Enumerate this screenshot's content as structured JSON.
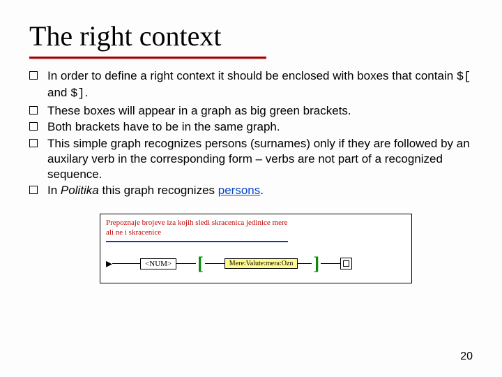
{
  "title": "The right context",
  "bullets": [
    {
      "pre": "In order to define a right context it should be enclosed with boxes that contain ",
      "code1": "$[",
      "mid": " and ",
      "code2": "$]",
      "post": "."
    },
    {
      "text": "These boxes will appear in a graph as big green brackets."
    },
    {
      "text": "Both brackets have to be in the same graph."
    },
    {
      "text": "This simple graph recognizes persons (surnames) only if they are followed by an auxilary verb in the corresponding form – verbs are not part of a recognized sequence."
    },
    {
      "pre": "In ",
      "italic": "Politika",
      "mid2": " this graph recognizes ",
      "link": "persons",
      "post": "."
    }
  ],
  "figure": {
    "caption_l1": "Prepoznaje brojeve iza kojih sledi skracenica jedinice mere",
    "caption_l2": "ali ne i skracenice",
    "node1": "<NUM>",
    "bracket_open": "[",
    "node2": "Mere:Valute:mera:Ozn",
    "bracket_close": "]"
  },
  "page": "20"
}
